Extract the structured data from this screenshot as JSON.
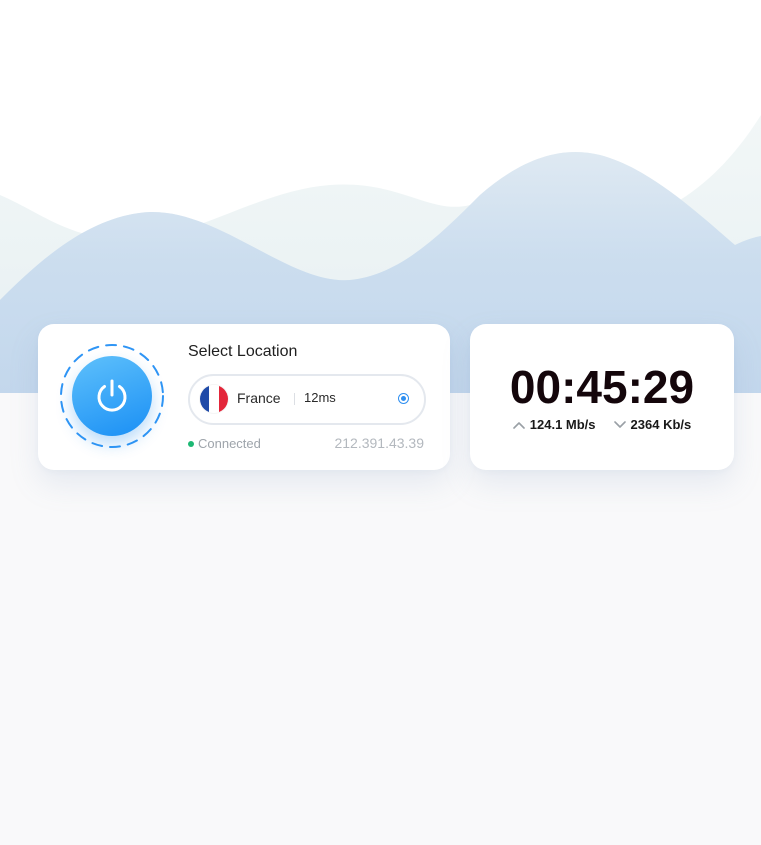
{
  "colors": {
    "accent": "#1a8ff5",
    "connected": "#1db874",
    "mountain_front": "#c6d9ec",
    "mountain_back": "#edf3f5"
  },
  "power": {
    "icon": "power-icon"
  },
  "location": {
    "title": "Select Location",
    "country": "France",
    "flag_icon": "france-flag-icon",
    "ping": "12ms",
    "selected_icon": "radio-selected-icon"
  },
  "connection": {
    "status": "Connected",
    "ip": "212.391.43.39"
  },
  "session": {
    "timer": "00:45:29",
    "upload_icon": "chevron-up-icon",
    "upload": "124.1 Mb/s",
    "download_icon": "chevron-down-icon",
    "download": "2364 Kb/s"
  }
}
